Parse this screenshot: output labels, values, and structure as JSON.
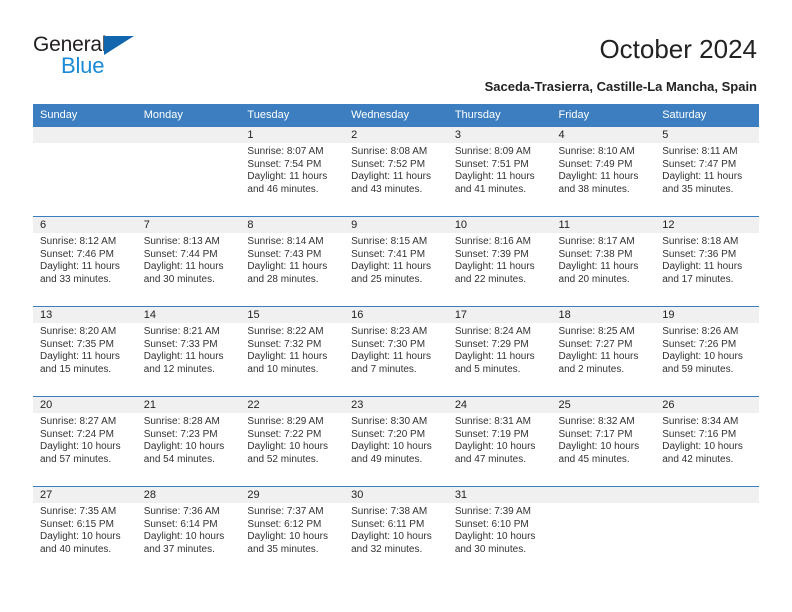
{
  "logo": {
    "word1": "General",
    "word2": "Blue",
    "triangle_color": "#1266ad",
    "blue_color": "#1b8ad6"
  },
  "header": {
    "title": "October 2024",
    "subtitle": "Saceda-Trasierra, Castille-La Mancha, Spain"
  },
  "theme": {
    "header_blue": "#3c7ebf",
    "daynum_band": "#f0f0f0"
  },
  "weekday_headers": [
    "Sunday",
    "Monday",
    "Tuesday",
    "Wednesday",
    "Thursday",
    "Friday",
    "Saturday"
  ],
  "weeks": [
    [
      {
        "day": "",
        "sunrise": "",
        "sunset": "",
        "daylight1": "",
        "daylight2": ""
      },
      {
        "day": "",
        "sunrise": "",
        "sunset": "",
        "daylight1": "",
        "daylight2": ""
      },
      {
        "day": "1",
        "sunrise": "Sunrise: 8:07 AM",
        "sunset": "Sunset: 7:54 PM",
        "daylight1": "Daylight: 11 hours",
        "daylight2": "and 46 minutes."
      },
      {
        "day": "2",
        "sunrise": "Sunrise: 8:08 AM",
        "sunset": "Sunset: 7:52 PM",
        "daylight1": "Daylight: 11 hours",
        "daylight2": "and 43 minutes."
      },
      {
        "day": "3",
        "sunrise": "Sunrise: 8:09 AM",
        "sunset": "Sunset: 7:51 PM",
        "daylight1": "Daylight: 11 hours",
        "daylight2": "and 41 minutes."
      },
      {
        "day": "4",
        "sunrise": "Sunrise: 8:10 AM",
        "sunset": "Sunset: 7:49 PM",
        "daylight1": "Daylight: 11 hours",
        "daylight2": "and 38 minutes."
      },
      {
        "day": "5",
        "sunrise": "Sunrise: 8:11 AM",
        "sunset": "Sunset: 7:47 PM",
        "daylight1": "Daylight: 11 hours",
        "daylight2": "and 35 minutes."
      }
    ],
    [
      {
        "day": "6",
        "sunrise": "Sunrise: 8:12 AM",
        "sunset": "Sunset: 7:46 PM",
        "daylight1": "Daylight: 11 hours",
        "daylight2": "and 33 minutes."
      },
      {
        "day": "7",
        "sunrise": "Sunrise: 8:13 AM",
        "sunset": "Sunset: 7:44 PM",
        "daylight1": "Daylight: 11 hours",
        "daylight2": "and 30 minutes."
      },
      {
        "day": "8",
        "sunrise": "Sunrise: 8:14 AM",
        "sunset": "Sunset: 7:43 PM",
        "daylight1": "Daylight: 11 hours",
        "daylight2": "and 28 minutes."
      },
      {
        "day": "9",
        "sunrise": "Sunrise: 8:15 AM",
        "sunset": "Sunset: 7:41 PM",
        "daylight1": "Daylight: 11 hours",
        "daylight2": "and 25 minutes."
      },
      {
        "day": "10",
        "sunrise": "Sunrise: 8:16 AM",
        "sunset": "Sunset: 7:39 PM",
        "daylight1": "Daylight: 11 hours",
        "daylight2": "and 22 minutes."
      },
      {
        "day": "11",
        "sunrise": "Sunrise: 8:17 AM",
        "sunset": "Sunset: 7:38 PM",
        "daylight1": "Daylight: 11 hours",
        "daylight2": "and 20 minutes."
      },
      {
        "day": "12",
        "sunrise": "Sunrise: 8:18 AM",
        "sunset": "Sunset: 7:36 PM",
        "daylight1": "Daylight: 11 hours",
        "daylight2": "and 17 minutes."
      }
    ],
    [
      {
        "day": "13",
        "sunrise": "Sunrise: 8:20 AM",
        "sunset": "Sunset: 7:35 PM",
        "daylight1": "Daylight: 11 hours",
        "daylight2": "and 15 minutes."
      },
      {
        "day": "14",
        "sunrise": "Sunrise: 8:21 AM",
        "sunset": "Sunset: 7:33 PM",
        "daylight1": "Daylight: 11 hours",
        "daylight2": "and 12 minutes."
      },
      {
        "day": "15",
        "sunrise": "Sunrise: 8:22 AM",
        "sunset": "Sunset: 7:32 PM",
        "daylight1": "Daylight: 11 hours",
        "daylight2": "and 10 minutes."
      },
      {
        "day": "16",
        "sunrise": "Sunrise: 8:23 AM",
        "sunset": "Sunset: 7:30 PM",
        "daylight1": "Daylight: 11 hours",
        "daylight2": "and 7 minutes."
      },
      {
        "day": "17",
        "sunrise": "Sunrise: 8:24 AM",
        "sunset": "Sunset: 7:29 PM",
        "daylight1": "Daylight: 11 hours",
        "daylight2": "and 5 minutes."
      },
      {
        "day": "18",
        "sunrise": "Sunrise: 8:25 AM",
        "sunset": "Sunset: 7:27 PM",
        "daylight1": "Daylight: 11 hours",
        "daylight2": "and 2 minutes."
      },
      {
        "day": "19",
        "sunrise": "Sunrise: 8:26 AM",
        "sunset": "Sunset: 7:26 PM",
        "daylight1": "Daylight: 10 hours",
        "daylight2": "and 59 minutes."
      }
    ],
    [
      {
        "day": "20",
        "sunrise": "Sunrise: 8:27 AM",
        "sunset": "Sunset: 7:24 PM",
        "daylight1": "Daylight: 10 hours",
        "daylight2": "and 57 minutes."
      },
      {
        "day": "21",
        "sunrise": "Sunrise: 8:28 AM",
        "sunset": "Sunset: 7:23 PM",
        "daylight1": "Daylight: 10 hours",
        "daylight2": "and 54 minutes."
      },
      {
        "day": "22",
        "sunrise": "Sunrise: 8:29 AM",
        "sunset": "Sunset: 7:22 PM",
        "daylight1": "Daylight: 10 hours",
        "daylight2": "and 52 minutes."
      },
      {
        "day": "23",
        "sunrise": "Sunrise: 8:30 AM",
        "sunset": "Sunset: 7:20 PM",
        "daylight1": "Daylight: 10 hours",
        "daylight2": "and 49 minutes."
      },
      {
        "day": "24",
        "sunrise": "Sunrise: 8:31 AM",
        "sunset": "Sunset: 7:19 PM",
        "daylight1": "Daylight: 10 hours",
        "daylight2": "and 47 minutes."
      },
      {
        "day": "25",
        "sunrise": "Sunrise: 8:32 AM",
        "sunset": "Sunset: 7:17 PM",
        "daylight1": "Daylight: 10 hours",
        "daylight2": "and 45 minutes."
      },
      {
        "day": "26",
        "sunrise": "Sunrise: 8:34 AM",
        "sunset": "Sunset: 7:16 PM",
        "daylight1": "Daylight: 10 hours",
        "daylight2": "and 42 minutes."
      }
    ],
    [
      {
        "day": "27",
        "sunrise": "Sunrise: 7:35 AM",
        "sunset": "Sunset: 6:15 PM",
        "daylight1": "Daylight: 10 hours",
        "daylight2": "and 40 minutes."
      },
      {
        "day": "28",
        "sunrise": "Sunrise: 7:36 AM",
        "sunset": "Sunset: 6:14 PM",
        "daylight1": "Daylight: 10 hours",
        "daylight2": "and 37 minutes."
      },
      {
        "day": "29",
        "sunrise": "Sunrise: 7:37 AM",
        "sunset": "Sunset: 6:12 PM",
        "daylight1": "Daylight: 10 hours",
        "daylight2": "and 35 minutes."
      },
      {
        "day": "30",
        "sunrise": "Sunrise: 7:38 AM",
        "sunset": "Sunset: 6:11 PM",
        "daylight1": "Daylight: 10 hours",
        "daylight2": "and 32 minutes."
      },
      {
        "day": "31",
        "sunrise": "Sunrise: 7:39 AM",
        "sunset": "Sunset: 6:10 PM",
        "daylight1": "Daylight: 10 hours",
        "daylight2": "and 30 minutes."
      },
      {
        "day": "",
        "sunrise": "",
        "sunset": "",
        "daylight1": "",
        "daylight2": ""
      },
      {
        "day": "",
        "sunrise": "",
        "sunset": "",
        "daylight1": "",
        "daylight2": ""
      }
    ]
  ]
}
